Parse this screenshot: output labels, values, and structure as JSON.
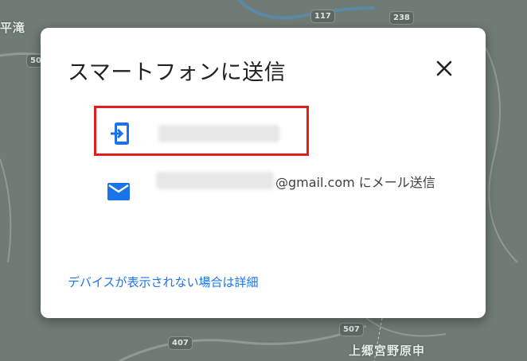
{
  "map": {
    "labels": [
      "平滝",
      "上郷宮野原申"
    ],
    "route_shields": [
      "117",
      "238",
      "507",
      "407",
      "507",
      "50"
    ]
  },
  "dialog": {
    "title": "スマートフォンに送信",
    "options": {
      "device": {
        "icon": "send-to-device-icon",
        "name": ""
      },
      "email": {
        "icon": "mail-icon",
        "text": "@gmail.com にメール送信"
      }
    },
    "help_link": "デバイスが表示されない場合は詳細"
  },
  "colors": {
    "accent": "#1a73e8",
    "highlight_border": "#e01e1e",
    "map_bg": "#6f7b74"
  }
}
